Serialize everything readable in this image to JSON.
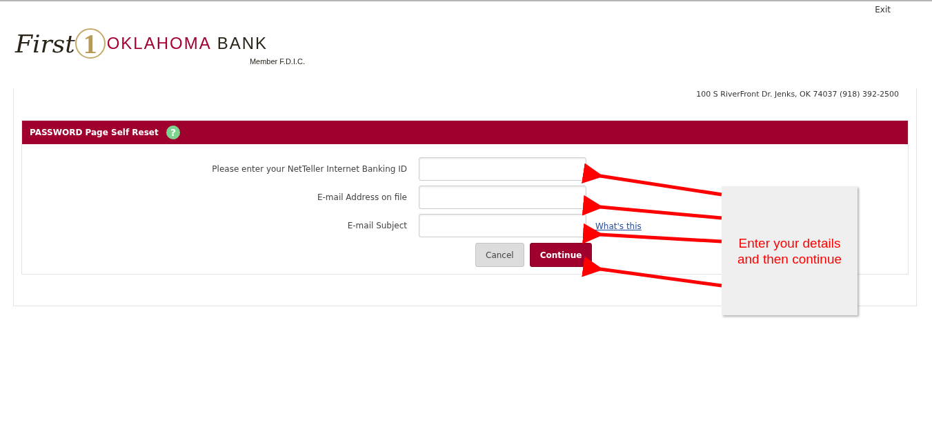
{
  "top_links": {
    "exit": "Exit"
  },
  "logo": {
    "script": "First",
    "numeral": "1",
    "name": "OKLAHOMA",
    "suffix": "BANK",
    "tagline": "Member F.D.I.C."
  },
  "address": "100 S RiverFront Dr. Jenks, OK 74037 (918) 392-2500",
  "panel": {
    "title": "PASSWORD Page Self Reset",
    "help_icon": "?"
  },
  "form": {
    "fields": [
      {
        "label": "Please enter your NetTeller Internet Banking ID"
      },
      {
        "label": "E-mail Address on file"
      },
      {
        "label": "E-mail Subject",
        "link": "What's this"
      }
    ],
    "buttons": [
      {
        "label": "Cancel",
        "kind": "secondary"
      },
      {
        "label": "Continue",
        "kind": "primary"
      }
    ]
  },
  "callout": {
    "lines": [
      "Enter your details",
      "and then continue"
    ]
  }
}
